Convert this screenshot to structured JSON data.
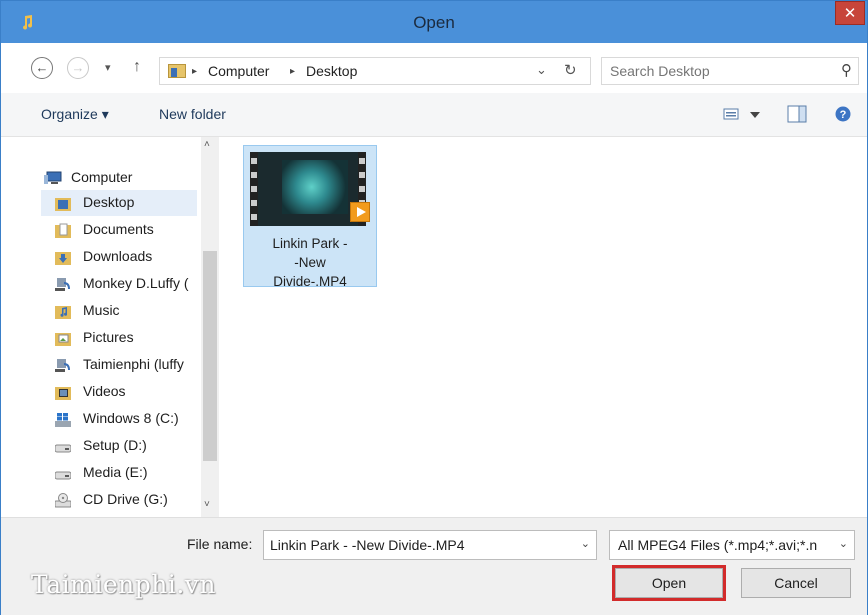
{
  "window": {
    "title": "Open",
    "close_glyph": "✕",
    "title_color": "#4a90d9"
  },
  "navigation": {
    "back_glyph": "←",
    "forward_glyph": "→",
    "recent_glyph": "▾",
    "up_glyph": "↑",
    "breadcrumb": [
      "Computer",
      "Desktop"
    ],
    "breadcrumb_separator": "▸",
    "address_dropdown_glyph": "⌄",
    "refresh_glyph": "↻"
  },
  "search": {
    "placeholder": "Search Desktop",
    "icon_glyph": "⚲"
  },
  "toolbar": {
    "organize_label": "Organize ▾",
    "new_folder_label": "New folder",
    "help_glyph": "?"
  },
  "sidebar": {
    "root": "Computer",
    "items": [
      {
        "label": "Desktop",
        "icon": "desktop-folder-icon",
        "selected": true
      },
      {
        "label": "Documents",
        "icon": "documents-folder-icon"
      },
      {
        "label": "Downloads",
        "icon": "downloads-folder-icon"
      },
      {
        "label": "Monkey D.Luffy (",
        "icon": "network-share-icon"
      },
      {
        "label": "Music",
        "icon": "music-folder-icon"
      },
      {
        "label": "Pictures",
        "icon": "pictures-folder-icon"
      },
      {
        "label": "Taimienphi (luffy",
        "icon": "network-share-icon"
      },
      {
        "label": "Videos",
        "icon": "videos-folder-icon"
      },
      {
        "label": "Windows 8 (C:)",
        "icon": "windows-drive-icon"
      },
      {
        "label": "Setup (D:)",
        "icon": "hard-drive-icon"
      },
      {
        "label": "Media (E:)",
        "icon": "hard-drive-icon"
      },
      {
        "label": "CD Drive (G:)",
        "icon": "cd-drive-icon"
      }
    ],
    "scroll_up_glyph": "˄",
    "scroll_down_glyph": "˅"
  },
  "files": [
    {
      "line1": "Linkin Park -",
      "line2": "-New",
      "line3": "Divide-.MP4",
      "selected": true
    }
  ],
  "footer": {
    "file_name_label": "File name:",
    "file_name_value": "Linkin Park - -New Divide-.MP4",
    "file_type_value": "All MPEG4 Files (*.mp4;*.avi;*.n",
    "dropdown_glyph": "⌄",
    "open_label": "Open",
    "cancel_label": "Cancel",
    "highlight_color": "#d22b2b"
  },
  "watermark": "Taimienphi.vn"
}
